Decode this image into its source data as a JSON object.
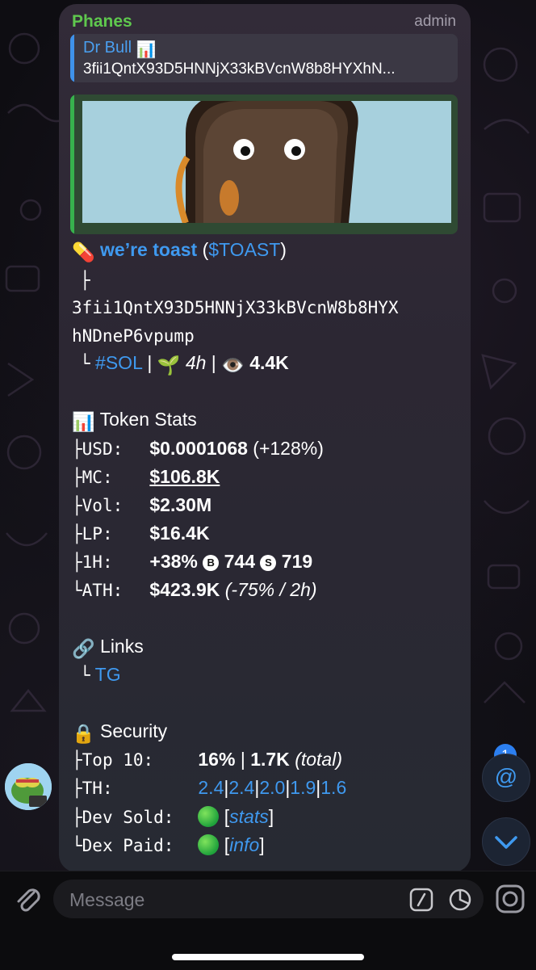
{
  "message": {
    "sender": "Phanes",
    "role": "admin",
    "reply": {
      "name": "Dr Bull",
      "name_emoji": "📊",
      "text": "3fii1QntX93D5HNNjX33kBVcnW8b8HYXhN..."
    },
    "token": {
      "pill_emoji": "💊",
      "name": "we’re toast",
      "ticker_open": "(",
      "ticker": "$TOAST",
      "ticker_close": ")",
      "tree_branch": "├",
      "address_line1": "3fii1QntX93D5HNNjX33kBVcnW8b8HYX",
      "address_line2": "hNDneP6vpump",
      "tree_end": "└",
      "chain": "#SOL",
      "sep": "|",
      "age_emoji": "🌱",
      "age": "4h",
      "views_emoji": "👁️",
      "views": "4.4K"
    },
    "stats": {
      "heading_emoji": "📊",
      "heading": "Token Stats",
      "rows": [
        {
          "prefix": "├",
          "label": "USD:",
          "value": "$0.0001068",
          "extra": "(+128%)"
        },
        {
          "prefix": "├",
          "label": "MC:",
          "value": "$106.8K"
        },
        {
          "prefix": "├",
          "label": "Vol:",
          "value": "$2.30M"
        },
        {
          "prefix": "├",
          "label": "LP:",
          "value": "$16.4K"
        },
        {
          "prefix": "├",
          "label": "1H:",
          "value": "+38%",
          "buy_icon": "B",
          "buys": "744",
          "sell_icon": "S",
          "sells": "719"
        },
        {
          "prefix": "└",
          "label": "ATH:",
          "value": "$423.9K",
          "extra": "(-75% / 2h)"
        }
      ]
    },
    "links": {
      "heading_emoji": "🔗",
      "heading": "Links",
      "prefix": "└",
      "items": [
        "TG"
      ]
    },
    "security": {
      "heading_emoji": "🔒",
      "heading": "Security",
      "top10": {
        "prefix": "├",
        "label": "Top 10:",
        "value": "16%",
        "sep": "|",
        "total": "1.7K",
        "total_note": "(total)"
      },
      "th": {
        "prefix": "├",
        "label": "TH:",
        "values": [
          "2.4",
          "2.4",
          "2.0",
          "1.9",
          "1.6"
        ],
        "sep": "|"
      },
      "dev_sold": {
        "prefix": "├",
        "label": "Dev Sold:",
        "link": "stats",
        "open": "[",
        "close": "]"
      },
      "dex_paid": {
        "prefix": "└",
        "label": "Dex Paid:",
        "link": "info",
        "open": "[",
        "close": "]"
      }
    }
  },
  "floating": {
    "mentions_count": "1",
    "mention_symbol": "@"
  },
  "composer": {
    "placeholder": "Message"
  },
  "colors": {
    "link": "#3f99ef",
    "sender": "#5fc84e",
    "status_green": "#1fa23b"
  }
}
